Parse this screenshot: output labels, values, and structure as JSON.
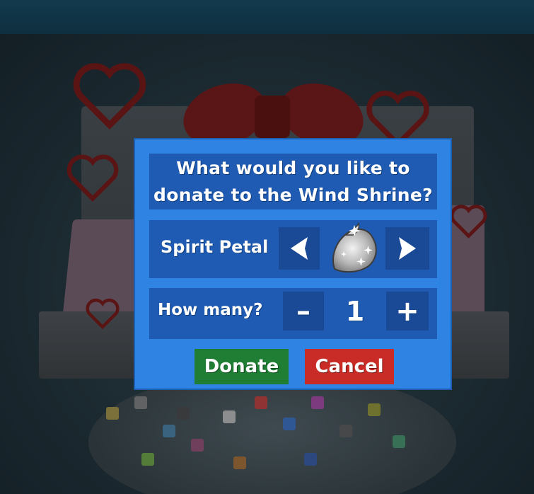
{
  "dialog": {
    "title": "What would you like to\ndonate to the Wind Shrine?",
    "item": {
      "label": "Spirit Petal",
      "icon": "spirit-petal-icon",
      "prev_icon": "arrow-left-icon",
      "next_icon": "arrow-right-icon"
    },
    "quantity": {
      "label": "How many?",
      "minus": "–",
      "value": "1",
      "plus": "+"
    },
    "buttons": {
      "donate": "Donate",
      "cancel": "Cancel"
    }
  },
  "colors": {
    "dialog_bg": "#2e83e3",
    "panel_bg": "#1f5bb2",
    "button_bg": "#1a4a95",
    "donate": "#1f7d34",
    "cancel": "#c92b26"
  }
}
